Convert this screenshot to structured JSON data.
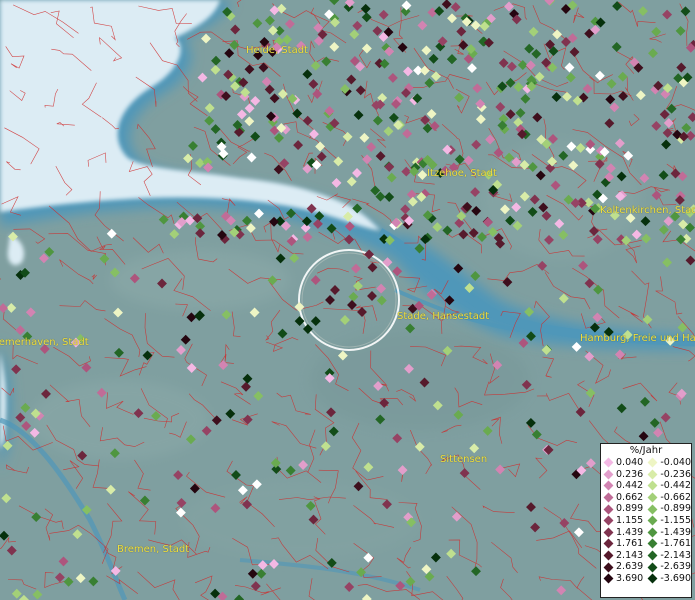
{
  "legend": {
    "title": "%/Jahr",
    "pos": [
      {
        "label": "0.040",
        "color": "#f4b8e4"
      },
      {
        "label": "0.236",
        "color": "#e29ecb"
      },
      {
        "label": "0.442",
        "color": "#d284b2"
      },
      {
        "label": "0.662",
        "color": "#c06c97"
      },
      {
        "label": "0.899",
        "color": "#ad557d"
      },
      {
        "label": "1.155",
        "color": "#964364"
      },
      {
        "label": "1.439",
        "color": "#80334f"
      },
      {
        "label": "1.761",
        "color": "#6c263d"
      },
      {
        "label": "2.143",
        "color": "#561a2c"
      },
      {
        "label": "2.639",
        "color": "#3e0f1d"
      },
      {
        "label": "3.690",
        "color": "#250610"
      }
    ],
    "neg": [
      {
        "label": "-0.040",
        "color": "#eef5c4"
      },
      {
        "label": "-0.236",
        "color": "#d8eca8"
      },
      {
        "label": "-0.442",
        "color": "#bfe08f"
      },
      {
        "label": "-0.662",
        "color": "#a3d078"
      },
      {
        "label": "-0.899",
        "color": "#86bf63"
      },
      {
        "label": "-1.155",
        "color": "#6aab50"
      },
      {
        "label": "-1.439",
        "color": "#4f9640"
      },
      {
        "label": "-1.761",
        "color": "#387f32"
      },
      {
        "label": "-2.143",
        "color": "#236625"
      },
      {
        "label": "-2.639",
        "color": "#124c18"
      },
      {
        "label": "-3.690",
        "color": "#06300c"
      }
    ]
  },
  "cities": [
    {
      "label": "Heide, Stadt"
    },
    {
      "label": "Itzehoe, Stadt"
    },
    {
      "label": "Kaltenkirchen, Stadt"
    },
    {
      "label": "Stade, Hansestadt"
    },
    {
      "label": "Bremerhaven, Stadt"
    },
    {
      "label": "Hamburg, Freie und Hansestadt"
    },
    {
      "label": "Sittensen"
    },
    {
      "label": "Bremen, Stadt"
    }
  ],
  "colors": {
    "land": "#7f9fa0",
    "sea": "#dcecf4",
    "river": "#4f97b9",
    "boundary": "#d02a2a",
    "city_label": "#f0e040",
    "selection_ring": "#ffffff"
  }
}
